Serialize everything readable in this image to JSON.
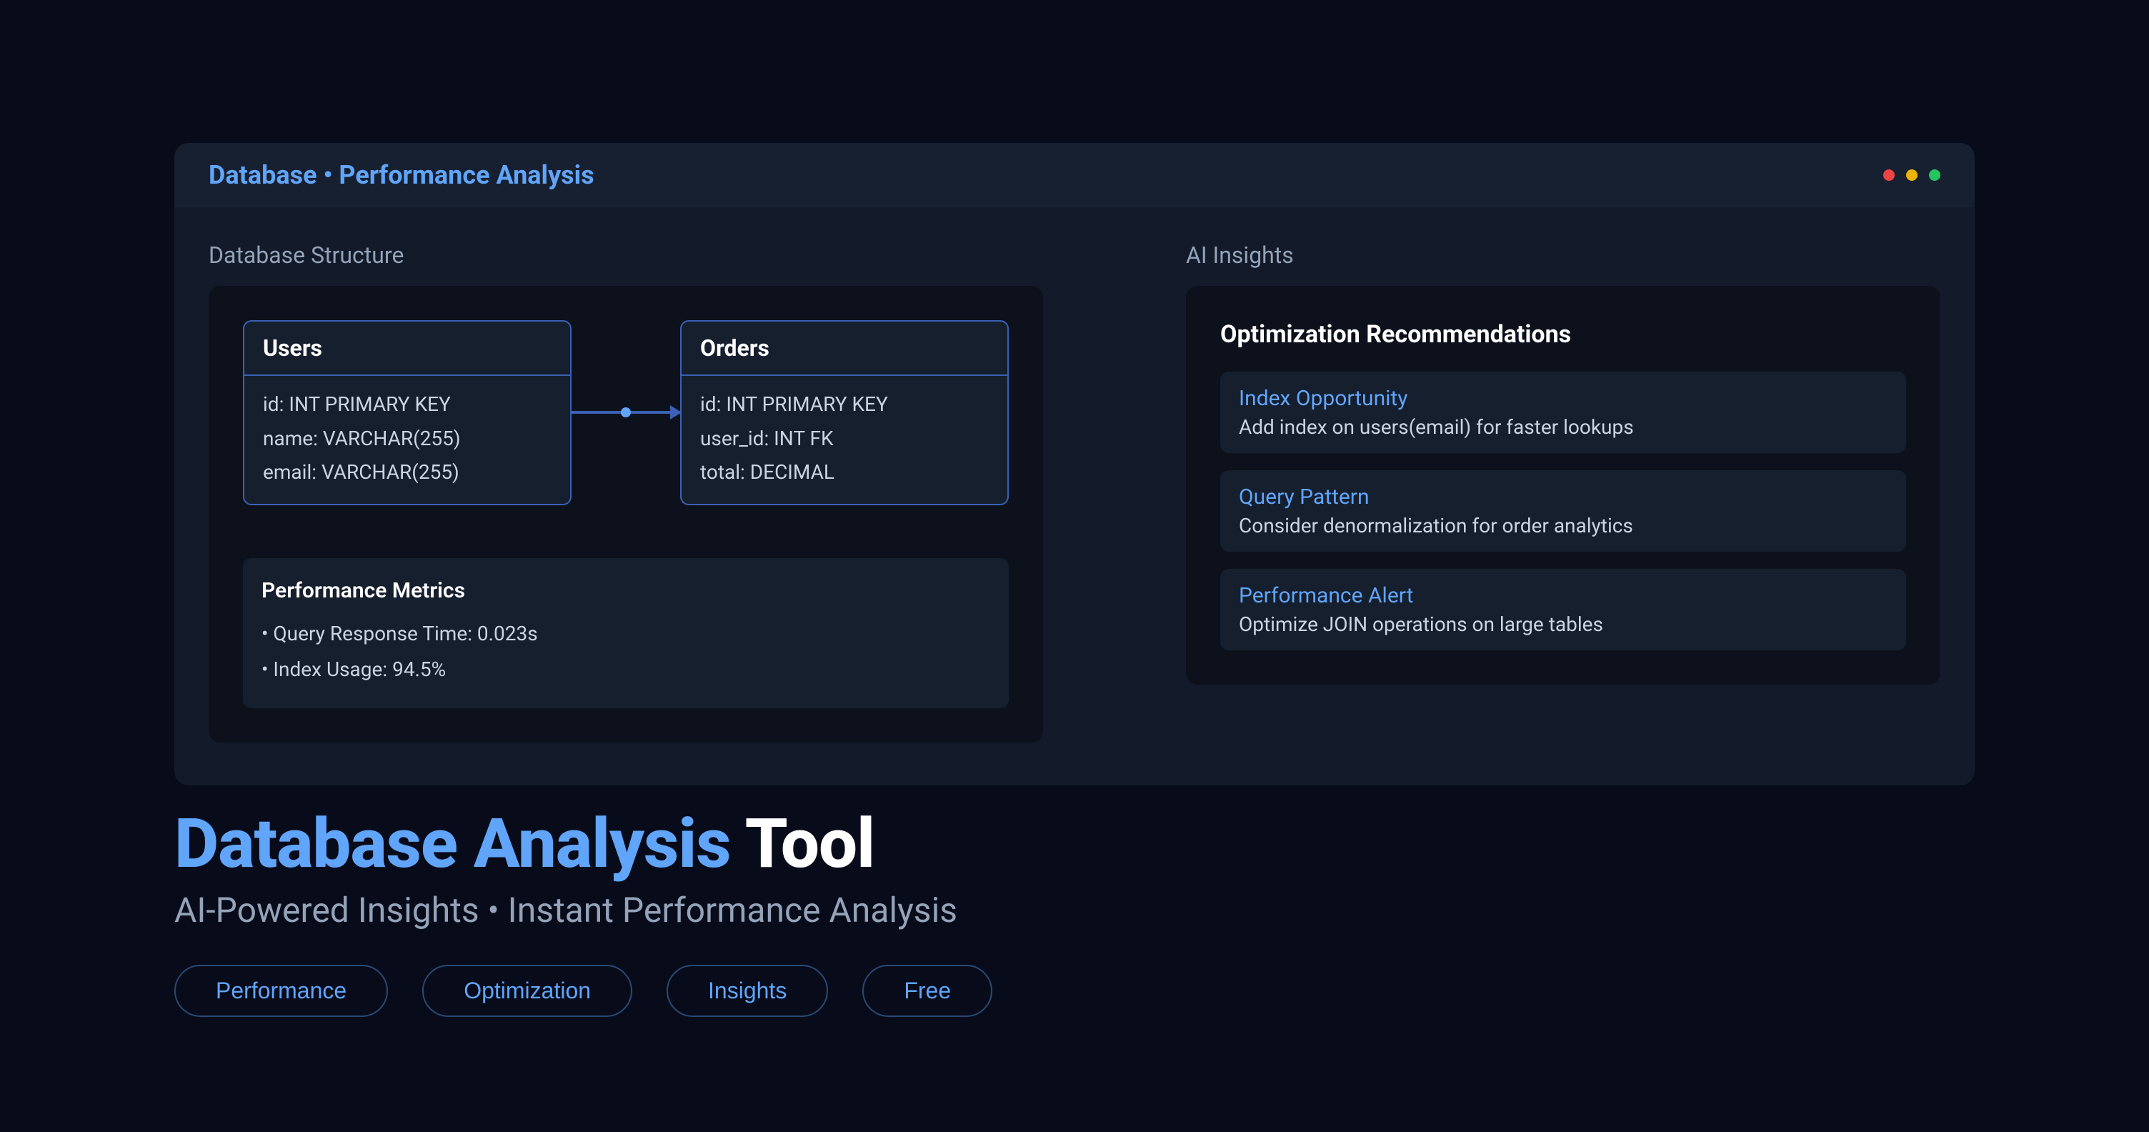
{
  "titlebar": {
    "breadcrumb": "Database • Performance Analysis"
  },
  "left": {
    "title": "Database Structure",
    "tables": [
      {
        "name": "Users",
        "columns": [
          "id: INT PRIMARY KEY",
          "name: VARCHAR(255)",
          "email: VARCHAR(255)"
        ]
      },
      {
        "name": "Orders",
        "columns": [
          "id: INT PRIMARY KEY",
          "user_id: INT FK",
          "total: DECIMAL"
        ]
      }
    ],
    "metrics": {
      "title": "Performance Metrics",
      "items": [
        "• Query Response Time: 0.023s",
        "• Index Usage: 94.5%"
      ]
    }
  },
  "right": {
    "title": "AI Insights",
    "card_title": "Optimization Recommendations",
    "items": [
      {
        "title": "Index Opportunity",
        "desc": "Add index on users(email) for faster lookups"
      },
      {
        "title": "Query Pattern",
        "desc": "Consider denormalization for order analytics"
      },
      {
        "title": "Performance Alert",
        "desc": "Optimize JOIN operations on large tables"
      }
    ]
  },
  "heading": {
    "accent": "Database Analysis",
    "plain": " Tool"
  },
  "subheading": "AI-Powered Insights • Instant Performance Analysis",
  "chips": [
    "Performance",
    "Optimization",
    "Insights",
    "Free"
  ]
}
